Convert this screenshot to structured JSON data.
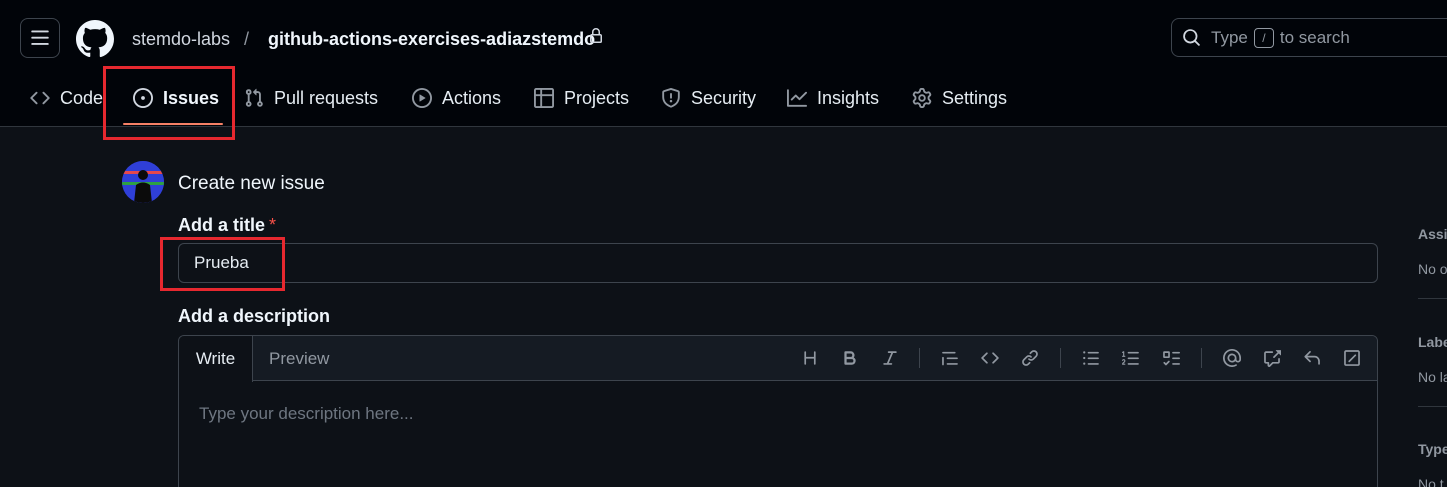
{
  "header": {
    "owner": "stemdo-labs",
    "separator": "/",
    "repo": "github-actions-exercises-adiazstemdo",
    "search_prefix": "Type",
    "search_key": "/",
    "search_suffix": "to search"
  },
  "tabs": [
    {
      "label": "Code",
      "icon": "code-icon"
    },
    {
      "label": "Issues",
      "icon": "issue-opened-icon"
    },
    {
      "label": "Pull requests",
      "icon": "git-pull-request-icon"
    },
    {
      "label": "Actions",
      "icon": "play-icon"
    },
    {
      "label": "Projects",
      "icon": "table-icon"
    },
    {
      "label": "Security",
      "icon": "shield-icon"
    },
    {
      "label": "Insights",
      "icon": "graph-icon"
    },
    {
      "label": "Settings",
      "icon": "gear-icon"
    }
  ],
  "selected_tab": "Issues",
  "form": {
    "heading": "Create new issue",
    "title_label": "Add a title",
    "required_mark": "*",
    "title_value": "Prueba",
    "description_label": "Add a description",
    "write_tab": "Write",
    "preview_tab": "Preview",
    "description_placeholder": "Type your description here..."
  },
  "toolbar": [
    "heading-icon",
    "bold-icon",
    "italic-icon",
    "quote-icon",
    "code-icon",
    "link-icon",
    "unordered-list-icon",
    "ordered-list-icon",
    "task-list-icon",
    "mention-icon",
    "cross-reference-icon",
    "reply-icon",
    "fullscreen-icon"
  ],
  "sidebar": {
    "assignees_label": "Assig",
    "assignees_value": "No o",
    "labels_label": "Labe",
    "labels_value": "No la",
    "type_label": "Type",
    "type_value": "No t"
  },
  "colors": {
    "header_bg": "#010409",
    "page_bg": "#0d1117",
    "tab_underline": "#f78166",
    "annotation_red": "#e6282f",
    "required": "#f85149"
  }
}
